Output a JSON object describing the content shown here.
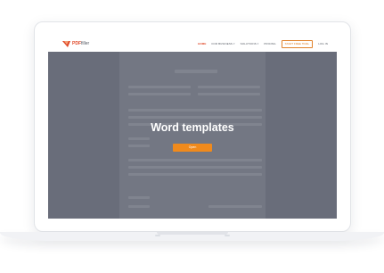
{
  "logo": {
    "brand": "PDF",
    "suffix": "filler",
    "icon": "pdffiller-logo-icon"
  },
  "nav": {
    "items": [
      "HOME",
      "FOR BUSINESS",
      "SOLUTIONS",
      "PRICING"
    ],
    "cta": "START FREE TRIAL",
    "login": "LOG IN"
  },
  "hero": {
    "title": "Word templates",
    "button": "Open"
  },
  "colors": {
    "accent": "#f08a1c",
    "brand": "#e04a2a",
    "overlay": "#6e7180"
  }
}
